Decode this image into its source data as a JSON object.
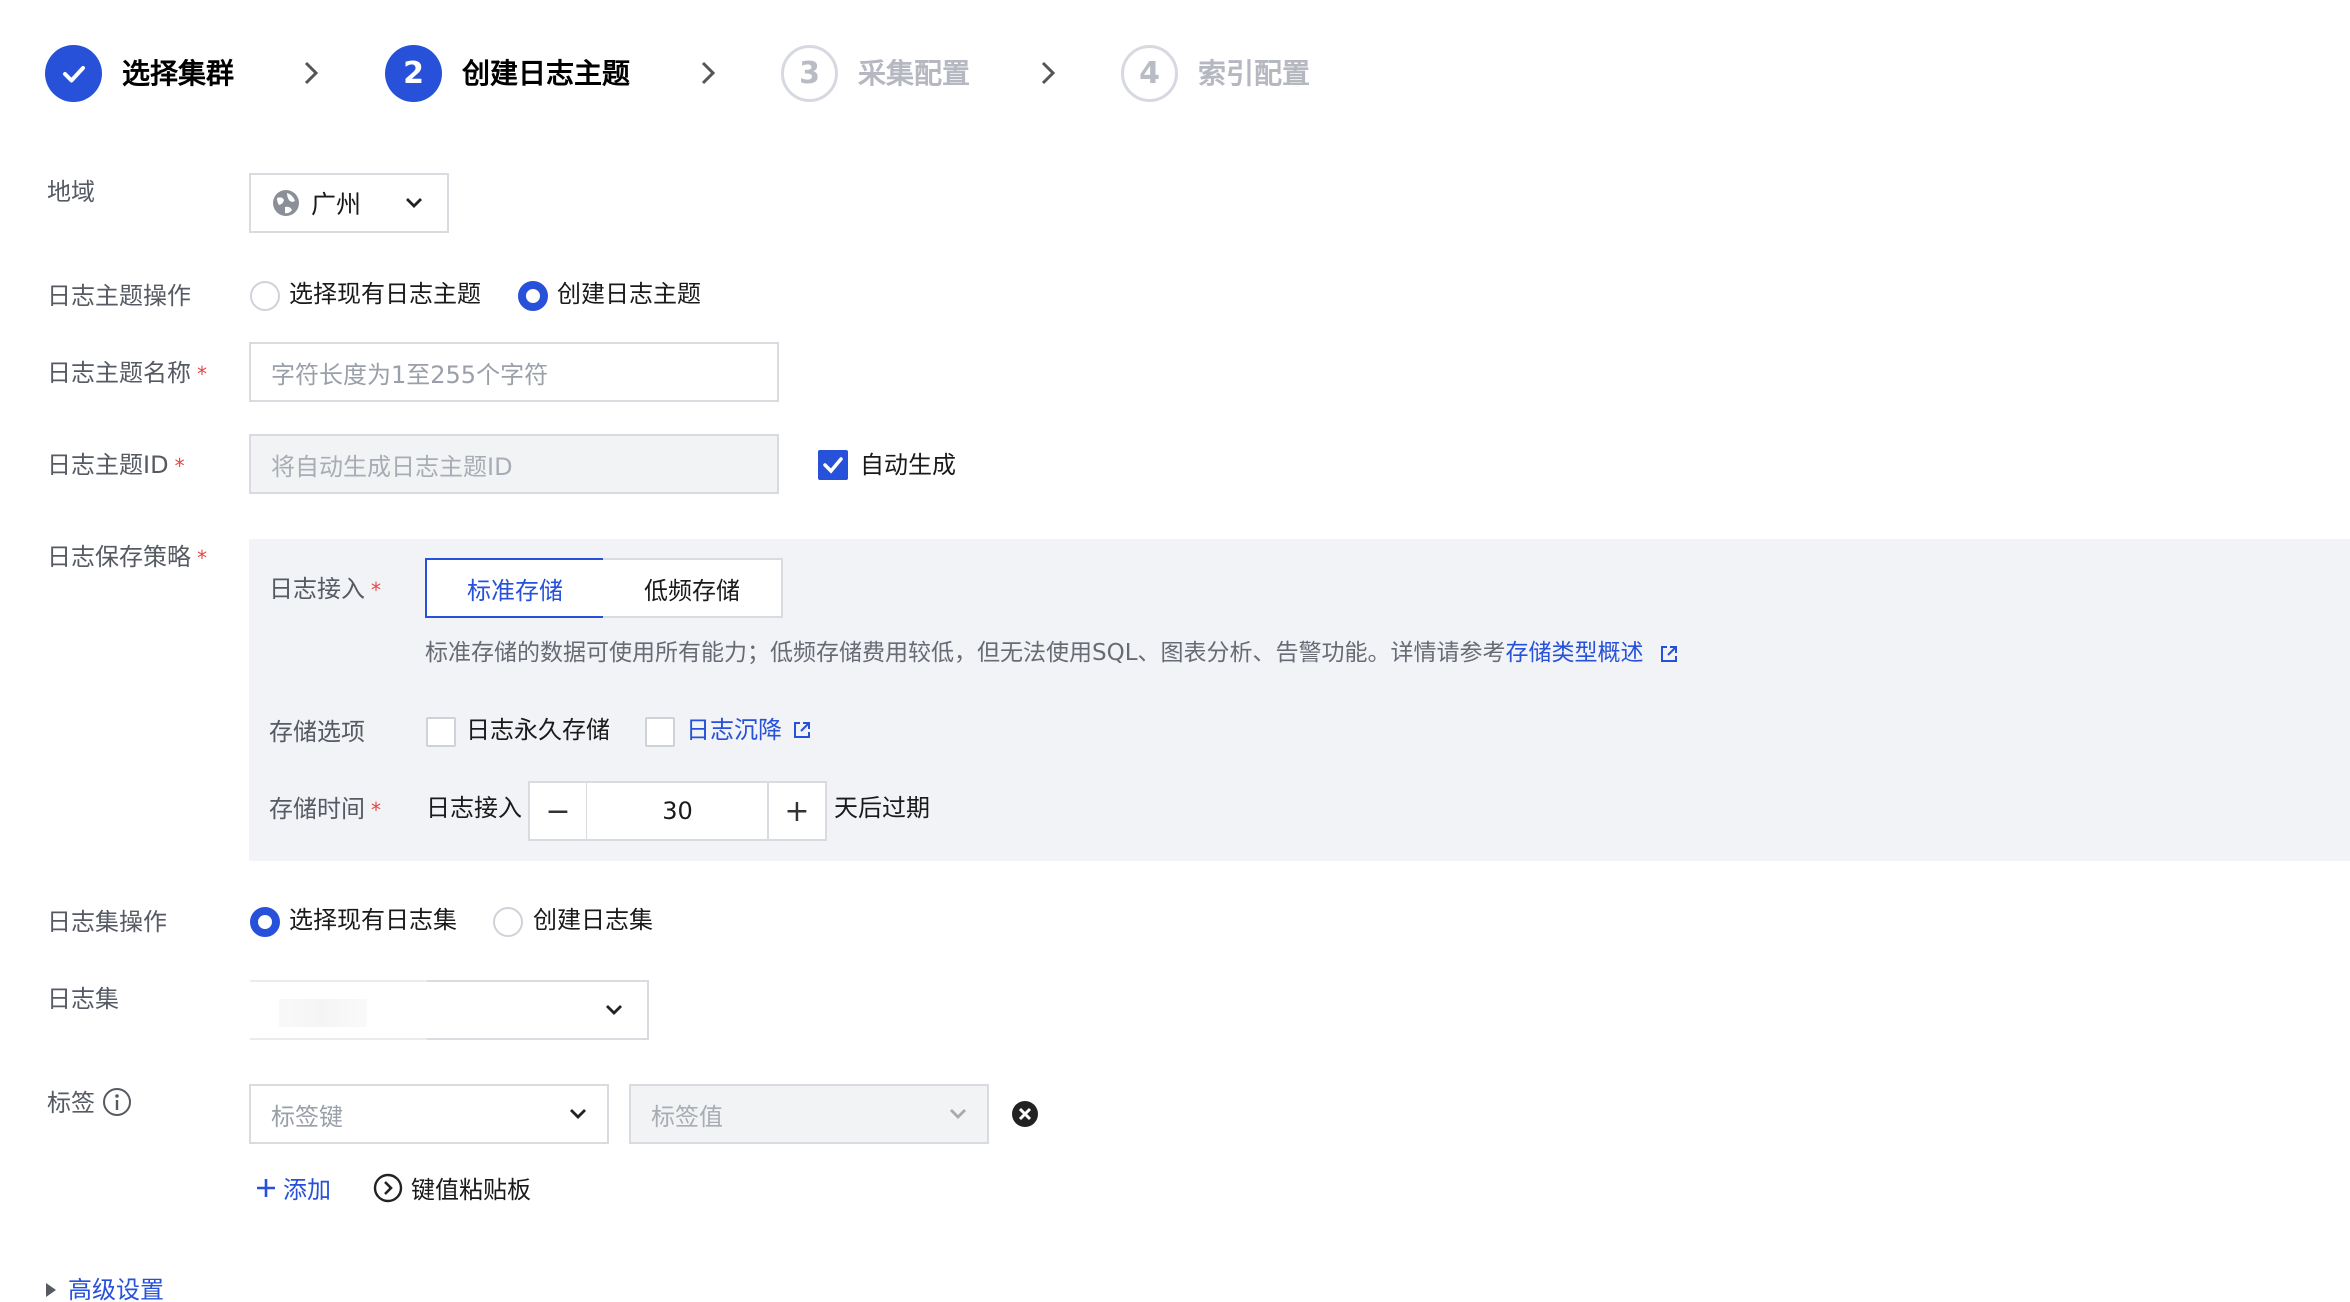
{
  "steps": [
    {
      "num": "✓",
      "label": "选择集群",
      "state": "done"
    },
    {
      "num": "2",
      "label": "创建日志主题",
      "state": "active"
    },
    {
      "num": "3",
      "label": "采集配置",
      "state": "pending"
    },
    {
      "num": "4",
      "label": "索引配置",
      "state": "pending"
    }
  ],
  "region": {
    "label": "地域",
    "value": "广州"
  },
  "topic_op": {
    "label": "日志主题操作",
    "option_existing": "选择现有日志主题",
    "option_create": "创建日志主题",
    "selected": "create"
  },
  "topic_name": {
    "label": "日志主题名称",
    "placeholder": "字符长度为1至255个字符"
  },
  "topic_id": {
    "label": "日志主题ID",
    "placeholder": "将自动生成日志主题ID",
    "auto_label": "自动生成",
    "auto_checked": true
  },
  "retention": {
    "label": "日志保存策略",
    "access_label": "日志接入",
    "standard": "标准存储",
    "infrequent": "低频存储",
    "selected": "standard",
    "desc": "标准存储的数据可使用所有能力；低频存储费用较低，但无法使用SQL、图表分析、告警功能。详情请参考",
    "desc_link": "存储类型概述",
    "options_label": "存储选项",
    "opt_permanent": "日志永久存储",
    "opt_sink": "日志沉降",
    "time_label": "存储时间",
    "time_prefix": "日志接入",
    "time_value": "30",
    "time_suffix": "天后过期",
    "minus": "−",
    "plus": "+"
  },
  "logset_op": {
    "label": "日志集操作",
    "option_existing": "选择现有日志集",
    "option_create": "创建日志集",
    "selected": "existing"
  },
  "logset": {
    "label": "日志集"
  },
  "tags": {
    "label": "标签",
    "key_placeholder": "标签键",
    "value_placeholder": "标签值",
    "add": "添加",
    "paste": "键值粘贴板"
  },
  "advanced": {
    "label": "高级设置"
  },
  "colors": {
    "primary": "#2651d8",
    "required": "#e54545"
  }
}
